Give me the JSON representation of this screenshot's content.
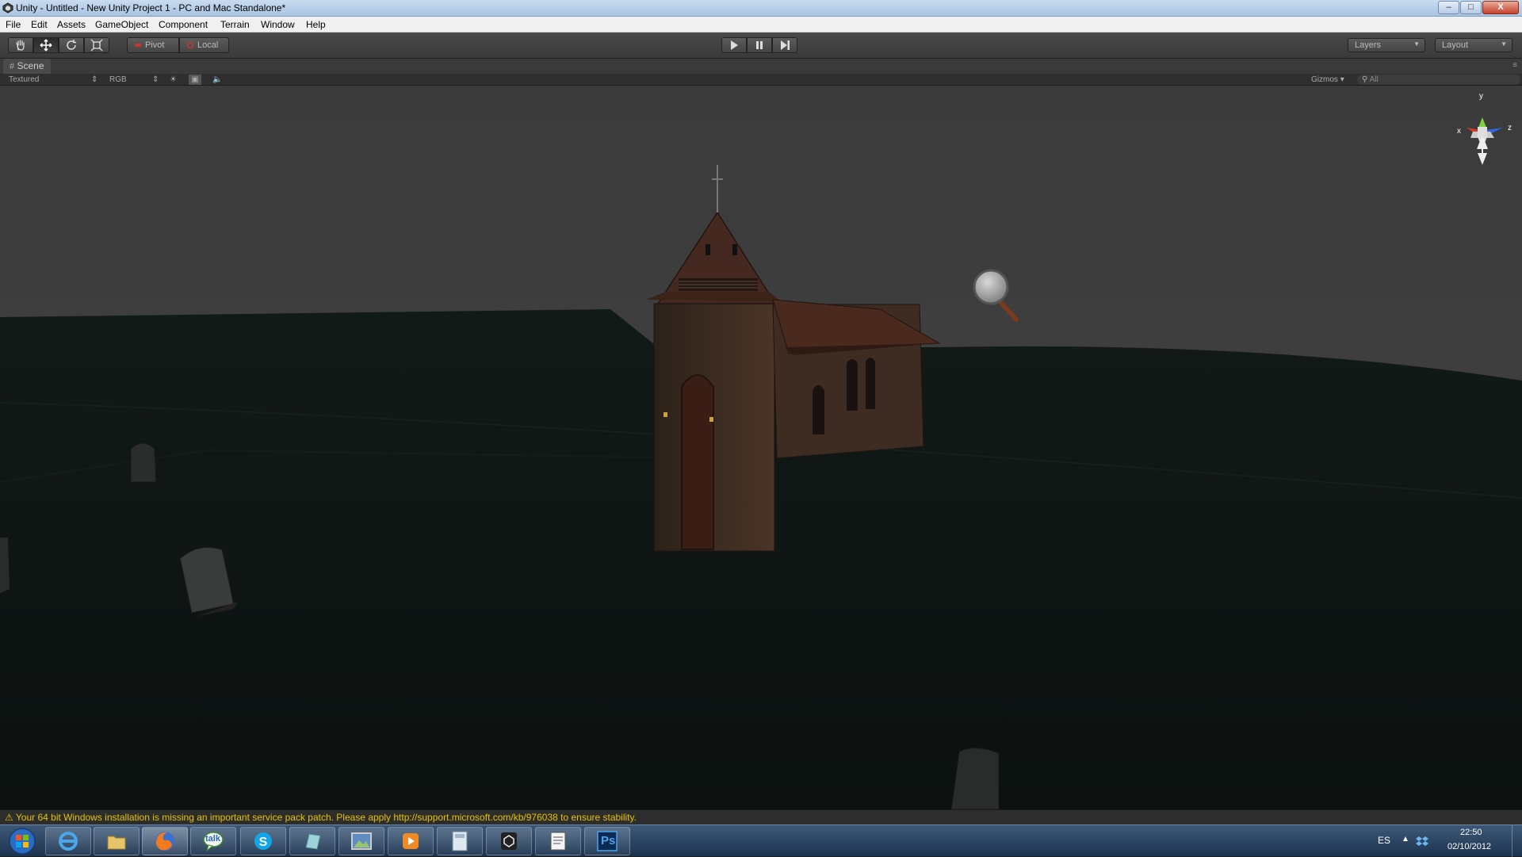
{
  "window": {
    "title": "Unity - Untitled - New Unity Project 1 - PC and Mac Standalone*",
    "controls": {
      "minimize": "–",
      "maximize": "□",
      "close": "X"
    }
  },
  "menu": [
    "File",
    "Edit",
    "Assets",
    "GameObject",
    "Component",
    "Terrain",
    "Window",
    "Help"
  ],
  "toolbar": {
    "pivot_label": "Pivot",
    "local_label": "Local",
    "layers_label": "Layers",
    "layout_label": "Layout"
  },
  "scene_tab": {
    "label": "Scene"
  },
  "scene_toolbar": {
    "render_mode": "Textured",
    "color_mode": "RGB",
    "gizmos_label": "Gizmos",
    "search_placeholder": "All"
  },
  "gizmo_axes": {
    "y": "y",
    "x": "x",
    "z": "z"
  },
  "status_message": "Your 64 bit Windows installation is missing an important service pack patch. Please apply http://support.microsoft.com/kb/976038 to ensure stability.",
  "taskbar": {
    "apps": [
      "internet-explorer-icon",
      "file-explorer-icon",
      "firefox-icon",
      "google-talk-icon",
      "skype-icon",
      "notepad-icon",
      "image-viewer-icon",
      "media-player-icon",
      "calculator-icon",
      "unity-icon",
      "text-editor-icon",
      "photoshop-icon"
    ],
    "talk_label": "talk",
    "photoshop_label": "Ps",
    "language": "ES",
    "time": "22:50",
    "date": "02/10/2012"
  },
  "colors": {
    "sky": "#3e3e3e",
    "ground": "#0f1714",
    "status_text": "#e6c200"
  }
}
